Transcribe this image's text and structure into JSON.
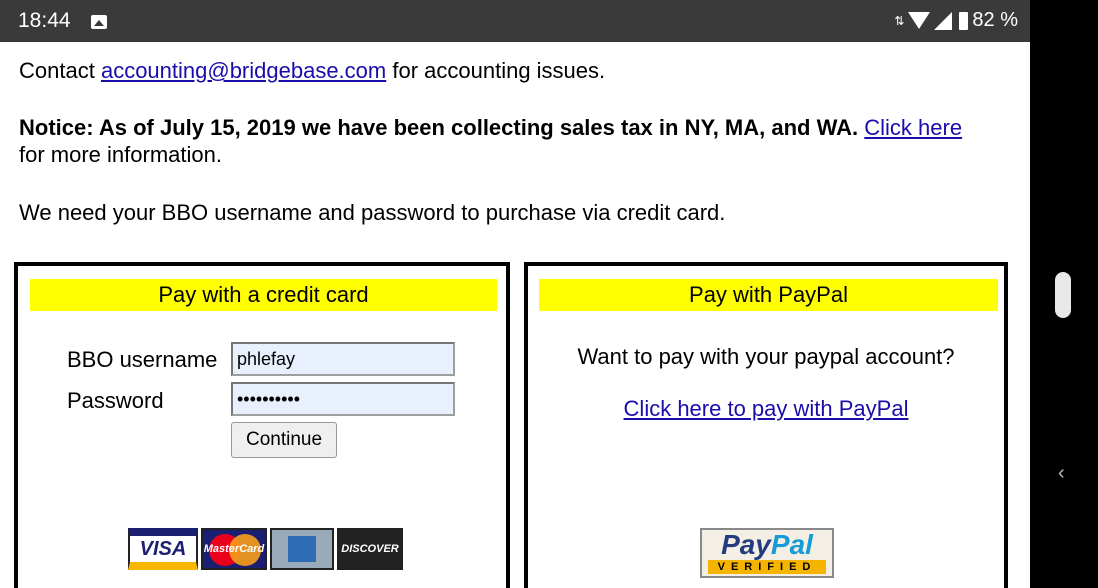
{
  "status_bar": {
    "time": "18:44",
    "battery": "82 %",
    "icons": [
      "image-icon",
      "data-arrows-icon",
      "wifi-icon",
      "signal-icon",
      "battery-icon"
    ]
  },
  "content": {
    "contact_prefix": "Contact",
    "contact_email": "accounting@bridgebase.com",
    "contact_suffix": "for accounting issues.",
    "notice_bold": "Notice: As of July 15, 2019 we have been collecting sales tax in NY, MA, and WA.",
    "notice_link": "Click here",
    "notice_rest": "for more information.",
    "need_text": "We need your BBO username and password to purchase via credit card."
  },
  "credit_card_box": {
    "header": "Pay with a credit card",
    "username_label": "BBO username",
    "username_value": "phlefay",
    "password_label": "Password",
    "password_value": "••••••••••",
    "continue_button": "Continue",
    "cards": {
      "visa": "VISA",
      "mastercard": "MasterCard",
      "discover": "DISCOVER"
    }
  },
  "paypal_box": {
    "header": "Pay with PayPal",
    "question": "Want to pay with your paypal account?",
    "link": "Click here to pay with PayPal",
    "badge_pay": "Pay",
    "badge_pal": "Pal",
    "badge_verified": "VERIFIED"
  },
  "colors": {
    "header_yellow": "#ffff00",
    "link_blue": "#1a0dab",
    "status_bar": "#3a3a3a"
  }
}
